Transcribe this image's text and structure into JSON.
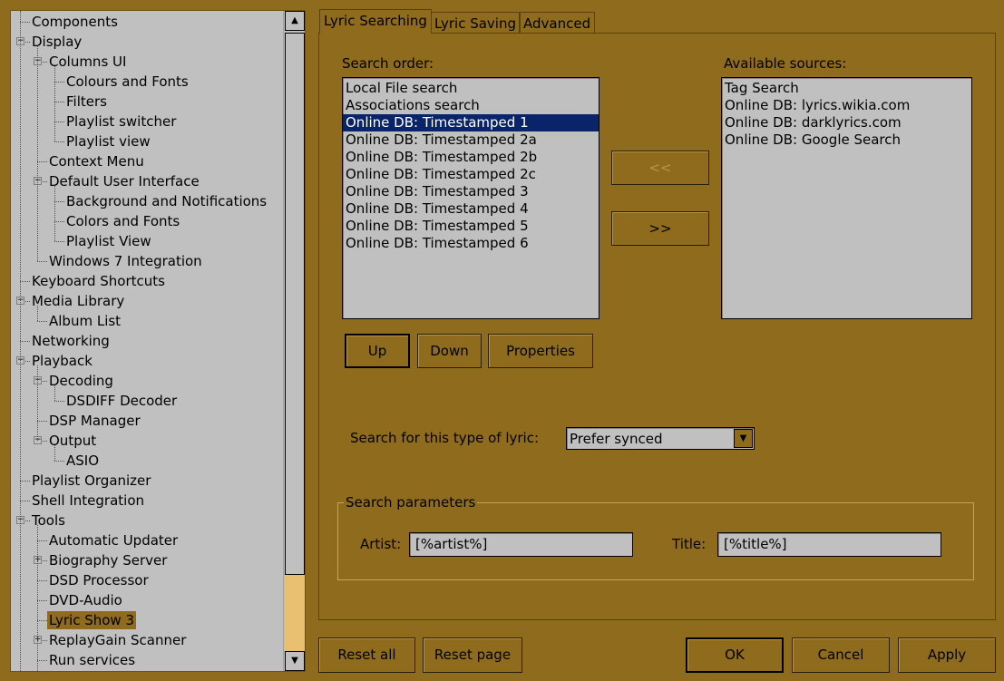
{
  "tree": {
    "items": [
      {
        "label": "Components",
        "level": 0,
        "expander": "none"
      },
      {
        "label": "Display",
        "level": 0,
        "expander": "minus"
      },
      {
        "label": "Columns UI",
        "level": 1,
        "expander": "minus"
      },
      {
        "label": "Colours and Fonts",
        "level": 2,
        "expander": "none"
      },
      {
        "label": "Filters",
        "level": 2,
        "expander": "none"
      },
      {
        "label": "Playlist switcher",
        "level": 2,
        "expander": "none"
      },
      {
        "label": "Playlist view",
        "level": 2,
        "expander": "none"
      },
      {
        "label": "Context Menu",
        "level": 1,
        "expander": "none"
      },
      {
        "label": "Default User Interface",
        "level": 1,
        "expander": "minus"
      },
      {
        "label": "Background and Notifications",
        "level": 2,
        "expander": "none"
      },
      {
        "label": "Colors and Fonts",
        "level": 2,
        "expander": "none"
      },
      {
        "label": "Playlist View",
        "level": 2,
        "expander": "none"
      },
      {
        "label": "Windows 7 Integration",
        "level": 1,
        "expander": "none"
      },
      {
        "label": "Keyboard Shortcuts",
        "level": 0,
        "expander": "none"
      },
      {
        "label": "Media Library",
        "level": 0,
        "expander": "minus"
      },
      {
        "label": "Album List",
        "level": 1,
        "expander": "none"
      },
      {
        "label": "Networking",
        "level": 0,
        "expander": "none"
      },
      {
        "label": "Playback",
        "level": 0,
        "expander": "minus"
      },
      {
        "label": "Decoding",
        "level": 1,
        "expander": "minus"
      },
      {
        "label": "DSDIFF Decoder",
        "level": 2,
        "expander": "none"
      },
      {
        "label": "DSP Manager",
        "level": 1,
        "expander": "none"
      },
      {
        "label": "Output",
        "level": 1,
        "expander": "minus"
      },
      {
        "label": "ASIO",
        "level": 2,
        "expander": "none"
      },
      {
        "label": "Playlist Organizer",
        "level": 0,
        "expander": "none"
      },
      {
        "label": "Shell Integration",
        "level": 0,
        "expander": "none"
      },
      {
        "label": "Tools",
        "level": 0,
        "expander": "minus"
      },
      {
        "label": "Automatic Updater",
        "level": 1,
        "expander": "none"
      },
      {
        "label": "Biography Server",
        "level": 1,
        "expander": "plus"
      },
      {
        "label": "DSD Processor",
        "level": 1,
        "expander": "none"
      },
      {
        "label": "DVD-Audio",
        "level": 1,
        "expander": "none"
      },
      {
        "label": "Lyric Show 3",
        "level": 1,
        "expander": "none",
        "selected": true
      },
      {
        "label": "ReplayGain Scanner",
        "level": 1,
        "expander": "plus"
      },
      {
        "label": "Run services",
        "level": 1,
        "expander": "none"
      }
    ],
    "scroll_up_icon": "▲",
    "scroll_down_icon": "▼"
  },
  "tabs": [
    {
      "label": "Lyric Searching",
      "active": true
    },
    {
      "label": "Lyric Saving",
      "active": false
    },
    {
      "label": "Advanced",
      "active": false
    }
  ],
  "search_order": {
    "label": "Search order:",
    "items": [
      {
        "text": "Local File search",
        "selected": false
      },
      {
        "text": "Associations search",
        "selected": false
      },
      {
        "text": "Online DB: Timestamped 1",
        "selected": true
      },
      {
        "text": "Online DB: Timestamped 2a",
        "selected": false
      },
      {
        "text": "Online DB: Timestamped 2b",
        "selected": false
      },
      {
        "text": "Online DB: Timestamped 2c",
        "selected": false
      },
      {
        "text": "Online DB: Timestamped 3",
        "selected": false
      },
      {
        "text": "Online DB: Timestamped 4",
        "selected": false
      },
      {
        "text": "Online DB: Timestamped 5",
        "selected": false
      },
      {
        "text": "Online DB: Timestamped 6",
        "selected": false
      }
    ]
  },
  "available_sources": {
    "label": "Available sources:",
    "items": [
      {
        "text": "Tag Search",
        "selected": false
      },
      {
        "text": "Online DB: lyrics.wikia.com",
        "selected": false
      },
      {
        "text": "Online DB: darklyrics.com",
        "selected": false
      },
      {
        "text": "Online DB: Google Search",
        "selected": false
      }
    ]
  },
  "move_buttons": {
    "add_label": "<<",
    "remove_label": ">>"
  },
  "order_buttons": {
    "up": "Up",
    "down": "Down",
    "properties": "Properties"
  },
  "lyric_type": {
    "label": "Search for this type of lyric:",
    "value": "Prefer synced",
    "dropdown_icon": "▼"
  },
  "search_params": {
    "legend": "Search parameters",
    "artist_label": "Artist:",
    "artist_value": "[%artist%]",
    "title_label": "Title:",
    "title_value": "[%title%]"
  },
  "footer": {
    "reset_all": "Reset all",
    "reset_page": "Reset page",
    "ok": "OK",
    "cancel": "Cancel",
    "apply": "Apply"
  },
  "colors": {
    "background": "#8f6b1e",
    "list_background": "#c0c0c0",
    "selection": "#0a246a"
  }
}
